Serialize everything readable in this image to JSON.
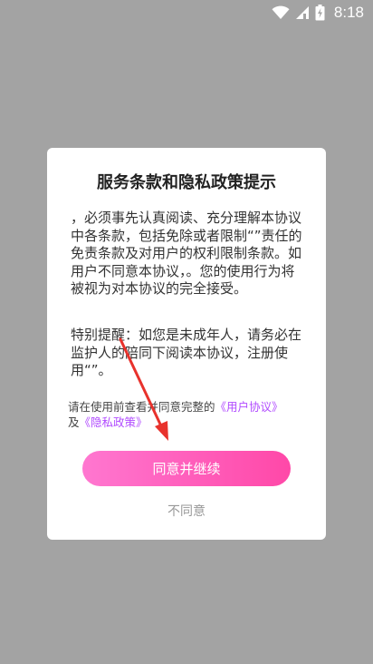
{
  "status_bar": {
    "time": "8:18",
    "icons": [
      "wifi-icon",
      "signal-icon",
      "battery-icon"
    ]
  },
  "dialog": {
    "title": "服务条款和隐私政策提示",
    "paragraph1": "，必须事先认真阅读、充分理解本协议中各条款，包括免除或者限制“”责任的免责条款及对用户的权利限制条款。如用户不同意本协议，。您的使用行为将被视为对本协议的完全接受。",
    "paragraph2": "特别提醒：如您是未成年人，请务必在监护人的陪同下阅读本协议，注册使用“”。",
    "agree_note_prefix": "请在使用前查看并同意完整的",
    "user_agreement_link": "《用户协议》",
    "agree_note_and": "及",
    "privacy_policy_link": "《隐私政策》",
    "continue_label": "同意并继续",
    "decline_label": "不同意"
  },
  "colors": {
    "overlay": "#a3a3a3",
    "button_start": "#ff77d0",
    "button_end": "#ff48a8",
    "link": "#b14bff",
    "annotation_arrow": "#e8322c"
  }
}
